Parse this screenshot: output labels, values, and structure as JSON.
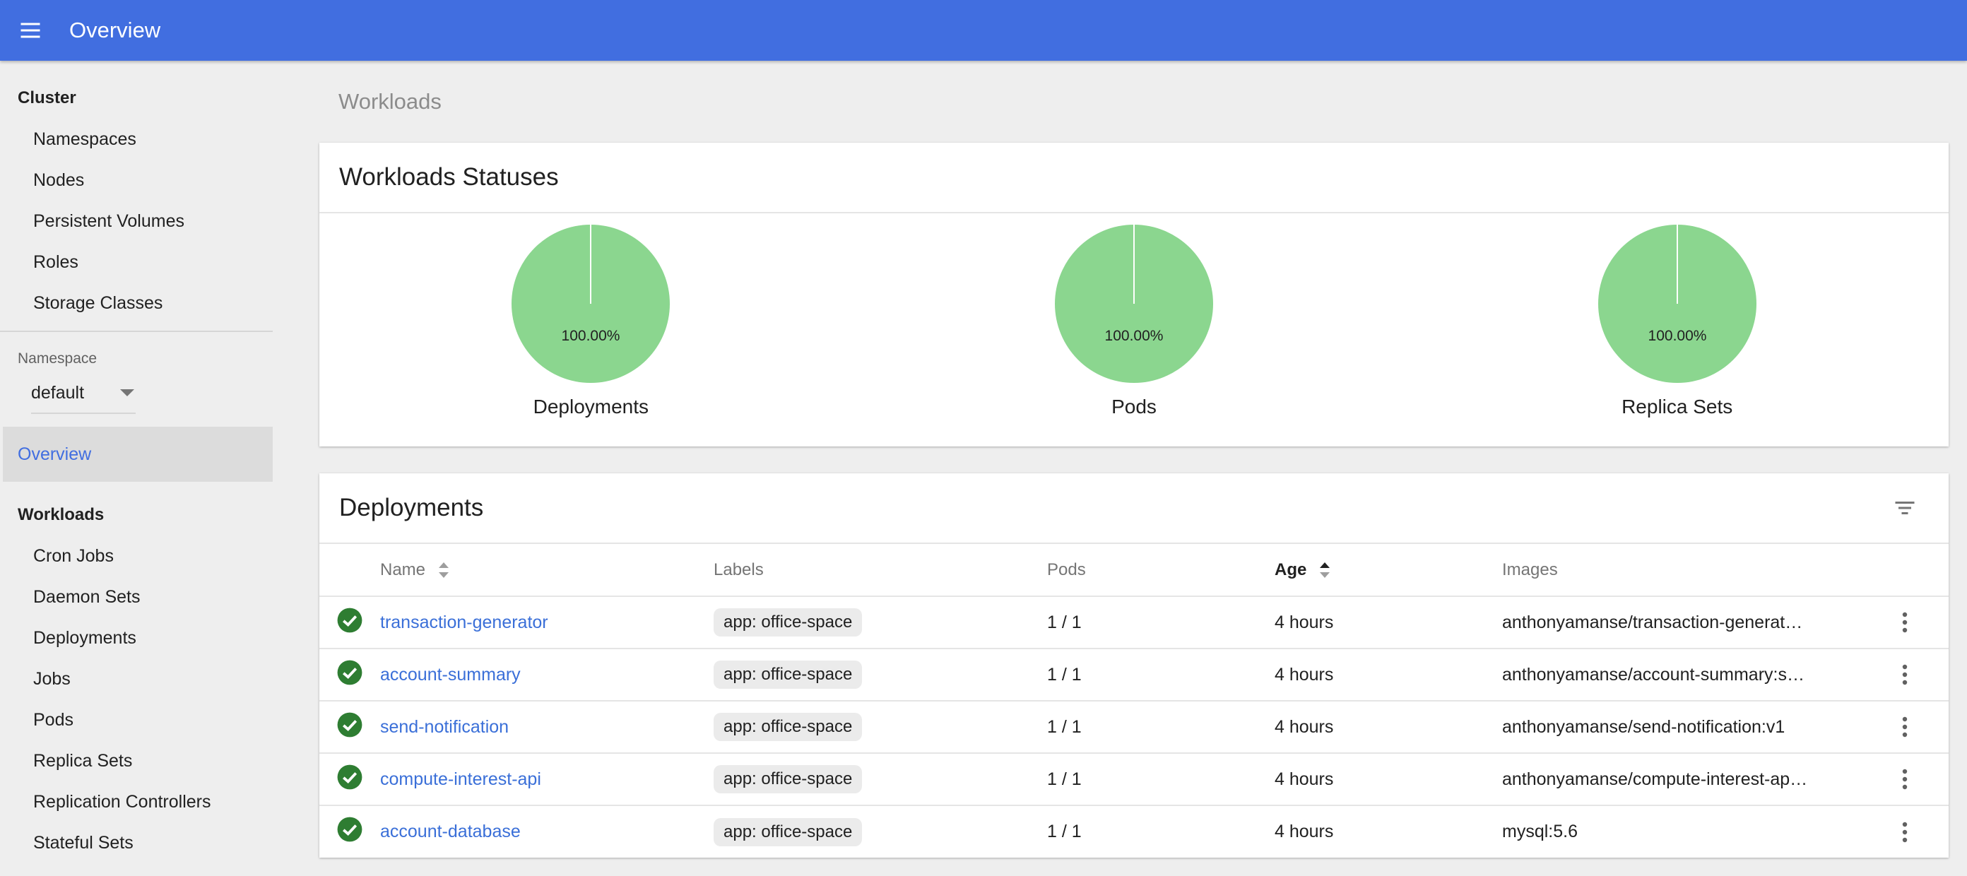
{
  "app": {
    "title": "Overview"
  },
  "sidebar": {
    "cluster_heading": "Cluster",
    "cluster_items": [
      "Namespaces",
      "Nodes",
      "Persistent Volumes",
      "Roles",
      "Storage Classes"
    ],
    "namespace_label": "Namespace",
    "namespace_value": "default",
    "overview_label": "Overview",
    "workloads_heading": "Workloads",
    "workload_items": [
      "Cron Jobs",
      "Daemon Sets",
      "Deployments",
      "Jobs",
      "Pods",
      "Replica Sets",
      "Replication Controllers",
      "Stateful Sets"
    ]
  },
  "main": {
    "breadcrumb": "Workloads",
    "statuses": {
      "title": "Workloads Statuses",
      "pies": [
        {
          "label": "Deployments",
          "percent_text": "100.00%"
        },
        {
          "label": "Pods",
          "percent_text": "100.00%"
        },
        {
          "label": "Replica Sets",
          "percent_text": "100.00%"
        }
      ]
    },
    "deployments": {
      "title": "Deployments",
      "columns": {
        "name": "Name",
        "labels": "Labels",
        "pods": "Pods",
        "age": "Age",
        "images": "Images"
      },
      "rows": [
        {
          "name": "transaction-generator",
          "label": "app: office-space",
          "pods": "1 / 1",
          "age": "4 hours",
          "image": "anthonyamanse/transaction-generat…"
        },
        {
          "name": "account-summary",
          "label": "app: office-space",
          "pods": "1 / 1",
          "age": "4 hours",
          "image": "anthonyamanse/account-summary:s…"
        },
        {
          "name": "send-notification",
          "label": "app: office-space",
          "pods": "1 / 1",
          "age": "4 hours",
          "image": "anthonyamanse/send-notification:v1"
        },
        {
          "name": "compute-interest-api",
          "label": "app: office-space",
          "pods": "1 / 1",
          "age": "4 hours",
          "image": "anthonyamanse/compute-interest-ap…"
        },
        {
          "name": "account-database",
          "label": "app: office-space",
          "pods": "1 / 1",
          "age": "4 hours",
          "image": "mysql:5.6"
        }
      ]
    }
  },
  "colors": {
    "primary": "#416ee0",
    "pie_green": "#8bd68f",
    "status_green": "#2e7d32",
    "link": "#3a6fd8"
  }
}
